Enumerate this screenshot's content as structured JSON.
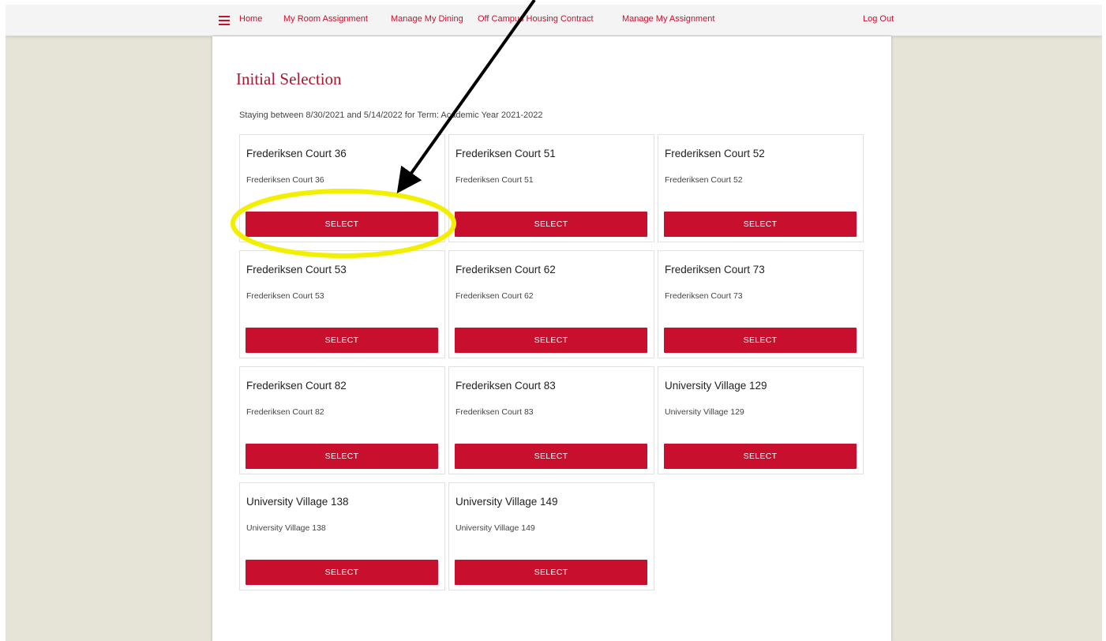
{
  "nav": {
    "menu_icon": "hamburger-menu-icon",
    "links": [
      "Home",
      "My Room Assignment",
      "Manage My Dining",
      "Off Campus Housing Contract",
      "Manage My Assignment"
    ],
    "logout": "Log Out"
  },
  "page": {
    "title": "Initial Selection",
    "stay_text": "Staying between 8/30/2021 and 5/14/2022 for Term: Academic Year 2021-2022"
  },
  "rooms": [
    {
      "title": "Frederiksen Court 36",
      "subtitle": "Frederiksen Court 36",
      "button": "SELECT"
    },
    {
      "title": "Frederiksen Court 51",
      "subtitle": "Frederiksen Court 51",
      "button": "SELECT"
    },
    {
      "title": "Frederiksen Court 52",
      "subtitle": "Frederiksen Court 52",
      "button": "SELECT"
    },
    {
      "title": "Frederiksen Court 53",
      "subtitle": "Frederiksen Court 53",
      "button": "SELECT"
    },
    {
      "title": "Frederiksen Court 62",
      "subtitle": "Frederiksen Court 62",
      "button": "SELECT"
    },
    {
      "title": "Frederiksen Court 73",
      "subtitle": "Frederiksen Court 73",
      "button": "SELECT"
    },
    {
      "title": "Frederiksen Court 82",
      "subtitle": "Frederiksen Court 82",
      "button": "SELECT"
    },
    {
      "title": "Frederiksen Court 83",
      "subtitle": "Frederiksen Court 83",
      "button": "SELECT"
    },
    {
      "title": "University Village 129",
      "subtitle": "University Village 129",
      "button": "SELECT"
    },
    {
      "title": "University Village 138",
      "subtitle": "University Village 138",
      "button": "SELECT"
    },
    {
      "title": "University Village 149",
      "subtitle": "University Village 149",
      "button": "SELECT"
    }
  ],
  "colors": {
    "accent": "#c8102e",
    "title": "#a8182e",
    "background": "#e5e4d7",
    "annotation_circle": "#f2ef00",
    "annotation_arrow": "#000000"
  }
}
